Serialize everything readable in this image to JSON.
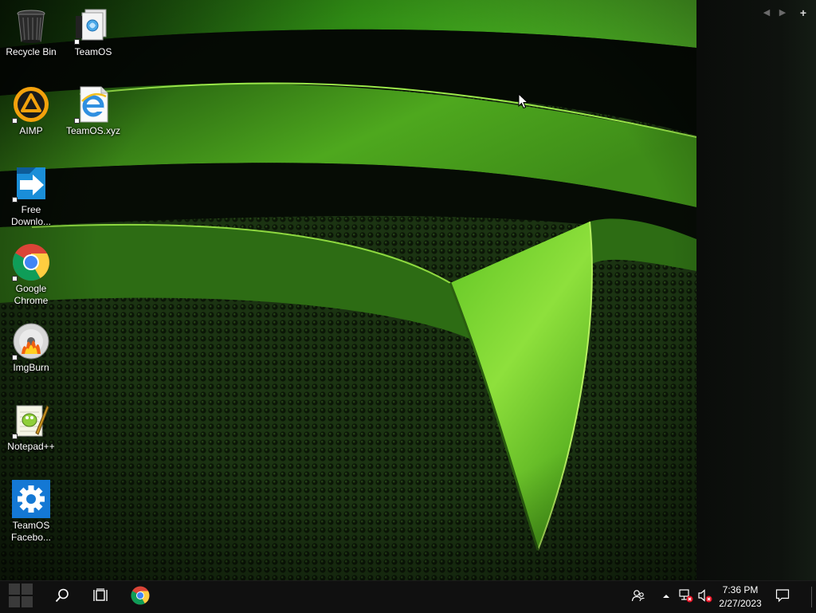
{
  "desktop": {
    "icons": [
      {
        "label": "Recycle Bin",
        "icon": "recycle-bin-icon"
      },
      {
        "label": "TeamOS",
        "icon": "teamos-document-icon"
      },
      {
        "label": "AIMP",
        "icon": "aimp-icon"
      },
      {
        "label": "TeamOS.xyz",
        "icon": "internet-explorer-icon"
      },
      {
        "label": "Free\nDownlo...",
        "icon": "free-download-manager-icon"
      },
      {
        "label": "Google\nChrome",
        "icon": "chrome-icon"
      },
      {
        "label": "ImgBurn",
        "icon": "imgburn-icon"
      },
      {
        "label": "Notepad++",
        "icon": "notepad-plus-plus-icon"
      },
      {
        "label": "TeamOS\nFacebo...",
        "icon": "gear-icon"
      }
    ]
  },
  "side_panel": {
    "prev_glyph": "◀",
    "next_glyph": "▶",
    "add_glyph": "+"
  },
  "taskbar": {
    "start_icon": "windows-start-icon",
    "search_icon": "search-icon",
    "task_view_icon": "task-view-icon",
    "pinned": [
      {
        "name": "Google Chrome",
        "icon": "chrome-icon"
      }
    ],
    "tray": {
      "people_icon": "people-icon",
      "overflow_icon": "chevron-up-icon",
      "network_icon": "network-disconnected-icon",
      "volume_icon": "volume-muted-icon",
      "time": "7:36 PM",
      "date": "2/27/2023",
      "notification_icon": "action-center-icon"
    }
  },
  "colors": {
    "accent_green": "#7fd626",
    "taskbar_bg": "#101010"
  }
}
